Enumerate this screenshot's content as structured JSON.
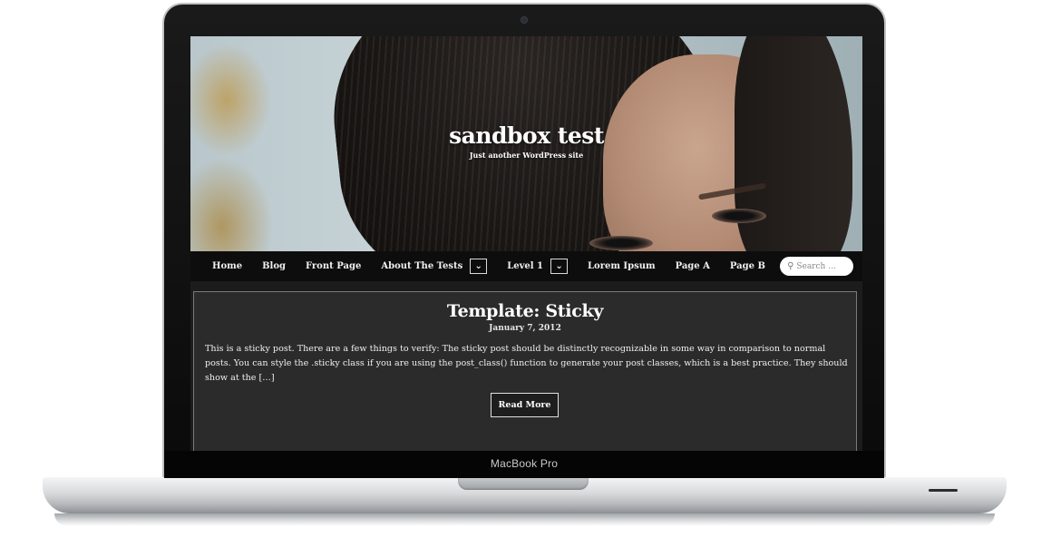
{
  "device": {
    "model_label": "MacBook Pro"
  },
  "site": {
    "title": "sandbox test",
    "tagline": "Just another WordPress site"
  },
  "nav": {
    "items": [
      {
        "label": "Home",
        "has_submenu": false
      },
      {
        "label": "Blog",
        "has_submenu": false
      },
      {
        "label": "Front Page",
        "has_submenu": false
      },
      {
        "label": "About The Tests",
        "has_submenu": true
      },
      {
        "label": "Level 1",
        "has_submenu": true
      },
      {
        "label": "Lorem Ipsum",
        "has_submenu": false
      },
      {
        "label": "Page A",
        "has_submenu": false
      },
      {
        "label": "Page B",
        "has_submenu": false
      }
    ],
    "submenu_toggle_glyph": "⌄"
  },
  "search": {
    "placeholder": "Search …",
    "icon": "magnifier-icon"
  },
  "post": {
    "title": "Template: Sticky",
    "date": "January 7, 2012",
    "excerpt": "This is a sticky post. There are a few things to verify: The sticky post should be distinctly recognizable in some way in comparison to normal posts. You can style the .sticky class if you are using the post_class() function to generate your post classes, which is a best practice. They should show at the […]",
    "read_more_label": "Read More"
  },
  "colors": {
    "nav_background": "#0d0d0d",
    "content_background": "#1c1c1c",
    "post_background": "#2b2b2b",
    "text": "#ffffff"
  }
}
